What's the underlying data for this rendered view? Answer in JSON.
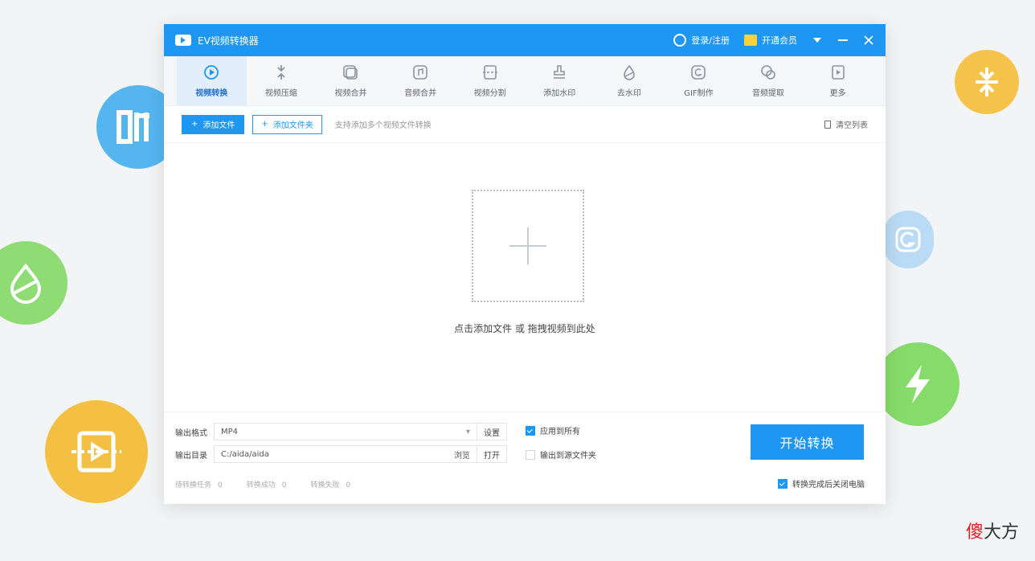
{
  "titlebar": {
    "app_title": "EV视频转换器",
    "link1": "登录/注册",
    "link2": "开通会员"
  },
  "toolbar": {
    "items": [
      {
        "label": "视频转换",
        "icon": "convert-icon",
        "active": true
      },
      {
        "label": "视频压缩",
        "icon": "compress-icon",
        "active": false
      },
      {
        "label": "视频合并",
        "icon": "merge-icon",
        "active": false
      },
      {
        "label": "音频合并",
        "icon": "audio-merge-icon",
        "active": false
      },
      {
        "label": "视频分割",
        "icon": "split-icon",
        "active": false
      },
      {
        "label": "添加水印",
        "icon": "stamp-icon",
        "active": false
      },
      {
        "label": "去水印",
        "icon": "drop-icon",
        "active": false
      },
      {
        "label": "GIF制作",
        "icon": "gif-icon",
        "active": false
      },
      {
        "label": "音频提取",
        "icon": "chat-icon",
        "active": false
      },
      {
        "label": "更多",
        "icon": "more-icon",
        "active": false
      }
    ]
  },
  "actionbar": {
    "add_file": "添加文件",
    "add_folder": "添加文件夹",
    "hint": "支持添加多个视频文件转换",
    "clear": "清空列表"
  },
  "dropzone": {
    "text": "点击添加文件 或 拖拽视频到此处"
  },
  "bottom": {
    "format_label": "输出格式",
    "format_value": "MP4",
    "settings_btn": "设置",
    "dir_label": "输出目录",
    "dir_value": "C:/aida/aida",
    "browse": "浏览",
    "open_btn": "打开",
    "apply_all": "应用到所有",
    "output_source": "输出到源文件夹",
    "start": "开始转换",
    "shutdown": "转换完成后关闭电脑",
    "stats": [
      {
        "label": "待转换任务",
        "value": "0"
      },
      {
        "label": "转换成功",
        "value": "0"
      },
      {
        "label": "转换失败",
        "value": "0"
      }
    ]
  },
  "watermark": {
    "red": "傻",
    "black": "大方"
  },
  "colors": {
    "accent": "#1e97f3",
    "deco_blue": "#55b6ef",
    "deco_green": "#8fdb74",
    "deco_yellow": "#f3c044"
  }
}
